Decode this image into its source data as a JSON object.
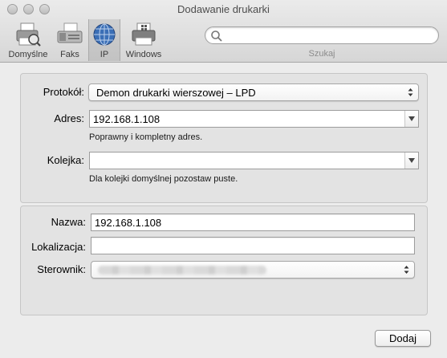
{
  "window": {
    "title": "Dodawanie drukarki"
  },
  "toolbar": {
    "items": [
      {
        "label": "Domyślne",
        "icon": "default-printer-icon"
      },
      {
        "label": "Faks",
        "icon": "fax-icon"
      },
      {
        "label": "IP",
        "icon": "globe-icon",
        "selected": true
      },
      {
        "label": "Windows",
        "icon": "windows-printer-icon"
      }
    ],
    "search": {
      "placeholder": "",
      "label": "Szukaj"
    }
  },
  "connection": {
    "protocol_label": "Protokół:",
    "protocol_value": "Demon drukarki wierszowej – LPD",
    "address_label": "Adres:",
    "address_value": "192.168.1.108",
    "address_hint": "Poprawny i kompletny adres.",
    "queue_label": "Kolejka:",
    "queue_value": "",
    "queue_hint": "Dla kolejki domyślnej pozostaw puste."
  },
  "printer": {
    "name_label": "Nazwa:",
    "name_value": "192.168.1.108",
    "location_label": "Lokalizacja:",
    "location_value": "",
    "driver_label": "Sterownik:"
  },
  "actions": {
    "add_label": "Dodaj"
  },
  "colors": {
    "accent_blue": "#3b6fb6",
    "window_bg": "#ececec"
  }
}
